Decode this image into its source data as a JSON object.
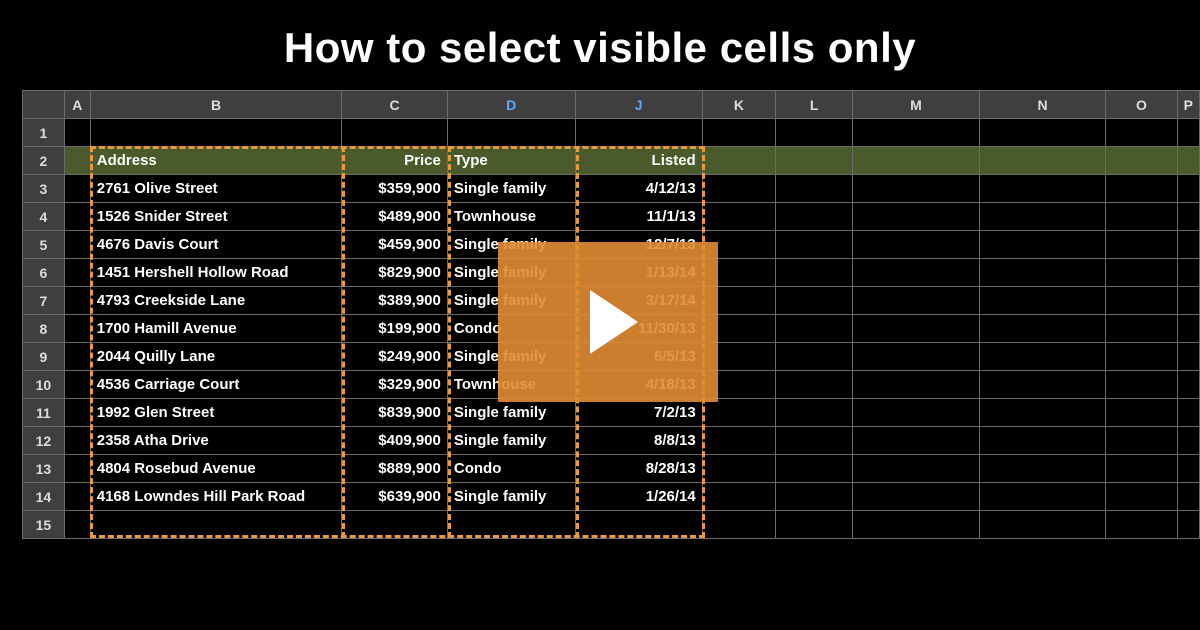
{
  "title": "How to select visible cells only",
  "columns": [
    "A",
    "B",
    "C",
    "D",
    "J",
    "K",
    "L",
    "M",
    "N",
    "O",
    "P"
  ],
  "blue_cols": [
    "D",
    "J"
  ],
  "headers": {
    "B": "Address",
    "C": "Price",
    "D": "Type",
    "J": "Listed"
  },
  "rows": [
    {
      "n": 1
    },
    {
      "n": 2,
      "B": "Address",
      "C": "Price",
      "D": "Type",
      "J": "Listed",
      "is_header": true
    },
    {
      "n": 3,
      "B": "2761 Olive Street",
      "C": "$359,900",
      "D": "Single family",
      "J": "4/12/13"
    },
    {
      "n": 4,
      "B": "1526 Snider Street",
      "C": "$489,900",
      "D": "Townhouse",
      "J": "11/1/13"
    },
    {
      "n": 5,
      "B": "4676 Davis Court",
      "C": "$459,900",
      "D": "Single family",
      "J": "12/7/13"
    },
    {
      "n": 6,
      "B": "1451 Hershell Hollow Road",
      "C": "$829,900",
      "D": "Single family",
      "J": "1/13/14"
    },
    {
      "n": 7,
      "B": "4793 Creekside Lane",
      "C": "$389,900",
      "D": "Single family",
      "J": "3/17/14"
    },
    {
      "n": 8,
      "B": "1700 Hamill Avenue",
      "C": "$199,900",
      "D": "Condo",
      "J": "11/30/13"
    },
    {
      "n": 9,
      "B": "2044 Quilly Lane",
      "C": "$249,900",
      "D": "Single family",
      "J": "6/5/13"
    },
    {
      "n": 10,
      "B": "4536 Carriage Court",
      "C": "$329,900",
      "D": "Townhouse",
      "J": "4/18/13"
    },
    {
      "n": 11,
      "B": "1992 Glen Street",
      "C": "$839,900",
      "D": "Single family",
      "J": "7/2/13"
    },
    {
      "n": 12,
      "B": "2358 Atha Drive",
      "C": "$409,900",
      "D": "Single family",
      "J": "8/8/13"
    },
    {
      "n": 13,
      "B": "4804 Rosebud Avenue",
      "C": "$889,900",
      "D": "Condo",
      "J": "8/28/13"
    },
    {
      "n": 14,
      "B": "4168 Lowndes Hill Park Road",
      "C": "$639,900",
      "D": "Single family",
      "J": "1/26/14"
    },
    {
      "n": 15
    }
  ],
  "chart_data": {
    "type": "table",
    "title": "How to select visible cells only",
    "columns": [
      "Address",
      "Price",
      "Type",
      "Listed"
    ],
    "rows": [
      [
        "2761 Olive Street",
        359900,
        "Single family",
        "4/12/13"
      ],
      [
        "1526 Snider Street",
        489900,
        "Townhouse",
        "11/1/13"
      ],
      [
        "4676 Davis Court",
        459900,
        "Single family",
        "12/7/13"
      ],
      [
        "1451 Hershell Hollow Road",
        829900,
        "Single family",
        "1/13/14"
      ],
      [
        "4793 Creekside Lane",
        389900,
        "Single family",
        "3/17/14"
      ],
      [
        "1700 Hamill Avenue",
        199900,
        "Condo",
        "11/30/13"
      ],
      [
        "2044 Quilly Lane",
        249900,
        "Single family",
        "6/5/13"
      ],
      [
        "4536 Carriage Court",
        329900,
        "Townhouse",
        "4/18/13"
      ],
      [
        "1992 Glen Street",
        839900,
        "Single family",
        "7/2/13"
      ],
      [
        "2358 Atha Drive",
        409900,
        "Single family",
        "8/8/13"
      ],
      [
        "4804 Rosebud Avenue",
        889900,
        "Condo",
        "8/28/13"
      ],
      [
        "4168 Lowndes Hill Park Road",
        639900,
        "Single family",
        "1/26/14"
      ]
    ]
  }
}
